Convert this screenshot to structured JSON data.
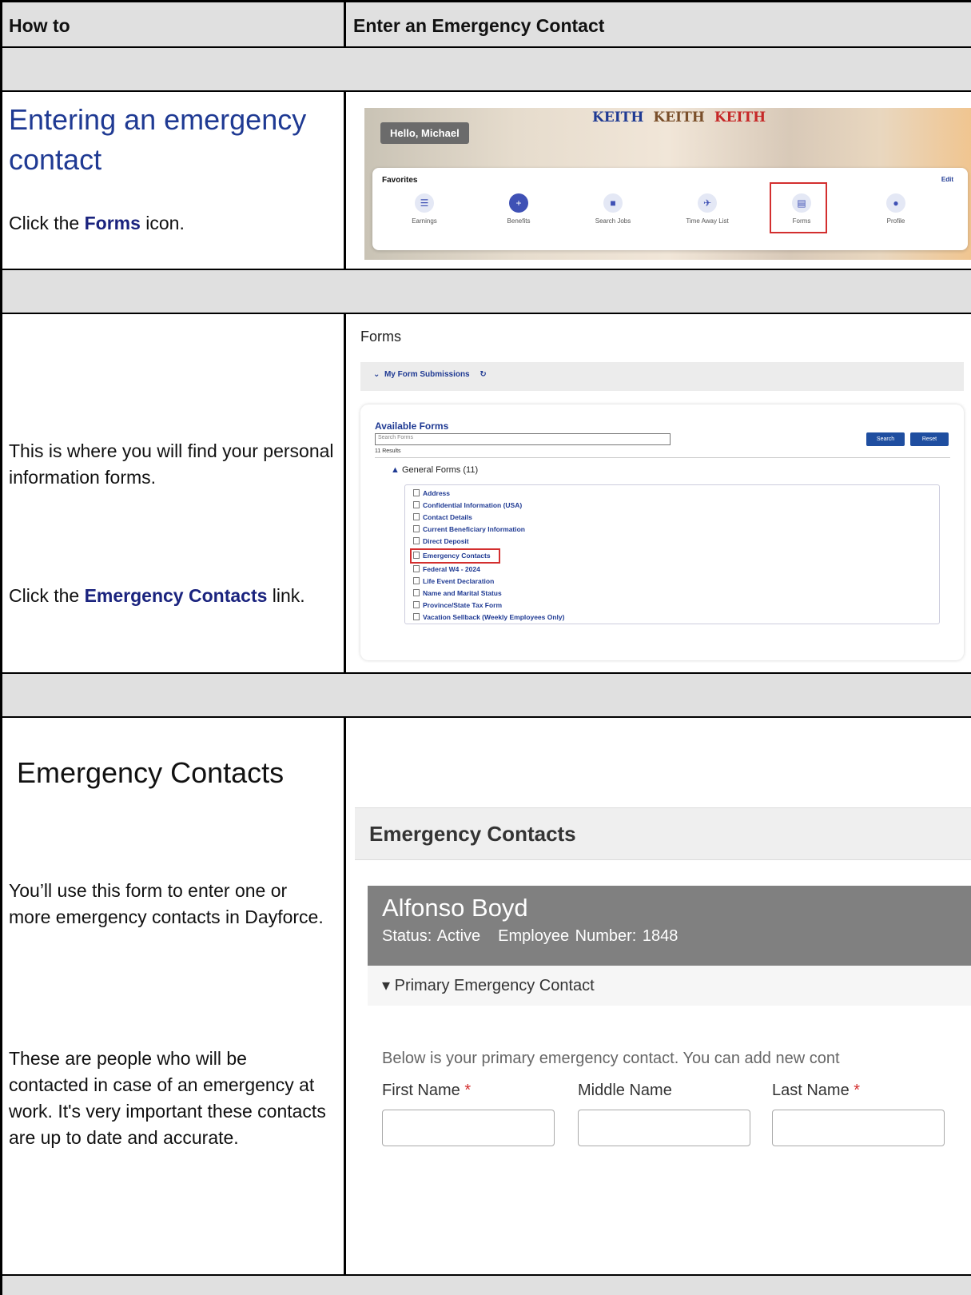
{
  "header": {
    "left": "How to",
    "right": "Enter an Emergency Contact"
  },
  "step1": {
    "title": "Entering an emergency contact",
    "text_pre": "Click the ",
    "text_bold": "Forms",
    "text_post": " icon.",
    "shot": {
      "greeting": "Hello, Michael",
      "logos": [
        "KEITH",
        "KEITH",
        "KEITH"
      ],
      "favorites_title": "Favorites",
      "edit": "Edit",
      "items": [
        {
          "label": "Earnings",
          "icon": "earnings-icon"
        },
        {
          "label": "Benefits",
          "icon": "plus-circle-icon"
        },
        {
          "label": "Search Jobs",
          "icon": "briefcase-icon"
        },
        {
          "label": "Time Away List",
          "icon": "airplane-icon"
        },
        {
          "label": "Forms",
          "icon": "form-icon"
        },
        {
          "label": "Profile",
          "icon": "person-icon"
        }
      ]
    }
  },
  "step2": {
    "text1": "This is where you will find your personal information forms.",
    "text2_pre": "Click the ",
    "text2_bold": "Emergency Contacts",
    "text2_post": " link.",
    "shot": {
      "title": "Forms",
      "submissions": "My Form Submissions",
      "available": "Available Forms",
      "search_placeholder": "Search Forms",
      "search_btn": "Search",
      "reset_btn": "Reset",
      "results": "11 Results",
      "group": "General Forms (11)",
      "forms": [
        "Address",
        "Confidential Information (USA)",
        "Contact Details",
        "Current Beneficiary Information",
        "Direct Deposit",
        "Emergency Contacts",
        "Federal W4 - 2024",
        "Life Event Declaration",
        "Name and Marital Status",
        "Province/State Tax Form",
        "Vacation Sellback (Weekly Employees Only)"
      ]
    }
  },
  "step3": {
    "title": "Emergency Contacts",
    "text1": "You’ll use this form to enter one or more emergency contacts in Dayforce.",
    "text2": "These are people who will be contacted in case of an emergency at work. It's very important these contacts are up to date and accurate.",
    "shot": {
      "heading": "Emergency Contacts",
      "employee_name": "Alfonso Boyd",
      "status": "Status: Active",
      "employee_number": "Employee Number: 1848",
      "section": "Primary Emergency Contact",
      "info": "Below is your primary emergency contact. You can add new cont",
      "first_name": "First Name",
      "middle_name": "Middle Name",
      "last_name": "Last Name",
      "required_mark": "*"
    }
  }
}
